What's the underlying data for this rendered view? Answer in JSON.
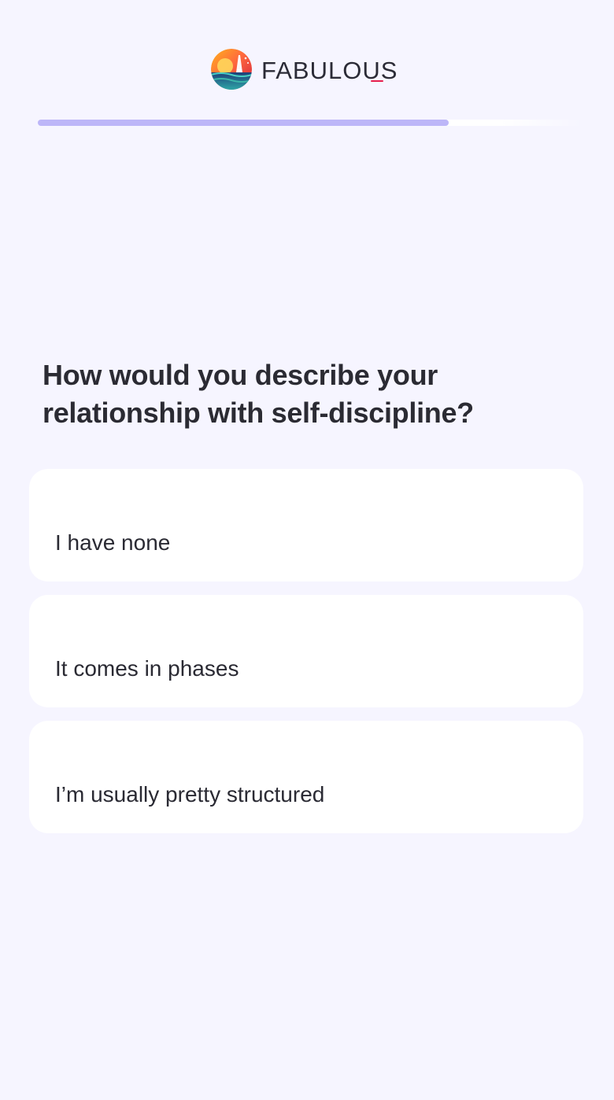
{
  "header": {
    "logo_text": "FABULOUS",
    "logo_icon": "fabulous-sunset-logo"
  },
  "progress": {
    "value": 0.754,
    "fill_color": "#bdb6f8"
  },
  "question": {
    "text": "How would you describe your relationship with self-discipline?"
  },
  "options": [
    {
      "label": "I have none"
    },
    {
      "label": "It comes in phases"
    },
    {
      "label": "I’m usually pretty structured"
    }
  ],
  "colors": {
    "background": "#f6f5ff",
    "card": "#ffffff",
    "text": "#2a2a33",
    "logo_accent": "#e61e4d"
  }
}
